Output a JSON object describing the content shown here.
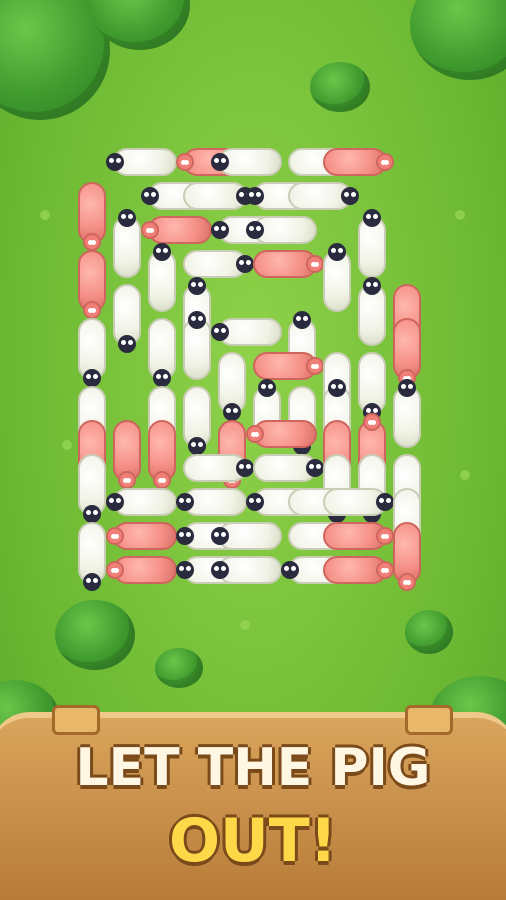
{
  "game": {
    "title_line1": "LET THE PIG",
    "title_line2": "OUT!",
    "colors": {
      "grass": "#72bd36",
      "sheep_body": "#f1f3e6",
      "sheep_head": "#2a2b3f",
      "pig_body": "#f48f86",
      "sign_wood": "#c98c45",
      "title_text": "#fff7e3",
      "title_accent": "#ffd84a"
    },
    "board": {
      "grid_columns": 9,
      "grid_rows": 13,
      "animals": [
        {
          "type": "sheep",
          "col": 1,
          "row": 0,
          "span": 2,
          "orient": "h",
          "facing": "left"
        },
        {
          "type": "pig",
          "col": 3,
          "row": 0,
          "span": 2,
          "orient": "h",
          "facing": "left"
        },
        {
          "type": "sheep",
          "col": 4,
          "row": 0,
          "span": 2,
          "orient": "h",
          "facing": "left"
        },
        {
          "type": "sheep",
          "col": 6,
          "row": 0,
          "span": 2,
          "orient": "h",
          "facing": "right"
        },
        {
          "type": "pig",
          "col": 7,
          "row": 0,
          "span": 2,
          "orient": "h",
          "facing": "right"
        },
        {
          "type": "pig",
          "col": 0,
          "row": 1,
          "span": 2,
          "orient": "v",
          "facing": "down"
        },
        {
          "type": "sheep",
          "col": 2,
          "row": 1,
          "span": 2,
          "orient": "h",
          "facing": "left"
        },
        {
          "type": "sheep",
          "col": 3,
          "row": 1,
          "span": 2,
          "orient": "h",
          "facing": "right"
        },
        {
          "type": "sheep",
          "col": 5,
          "row": 1,
          "span": 2,
          "orient": "h",
          "facing": "left"
        },
        {
          "type": "sheep",
          "col": 6,
          "row": 1,
          "span": 2,
          "orient": "h",
          "facing": "right"
        },
        {
          "type": "sheep",
          "col": 1,
          "row": 2,
          "span": 2,
          "orient": "v",
          "facing": "up"
        },
        {
          "type": "pig",
          "col": 2,
          "row": 2,
          "span": 2,
          "orient": "h",
          "facing": "left"
        },
        {
          "type": "sheep",
          "col": 4,
          "row": 2,
          "span": 2,
          "orient": "h",
          "facing": "left"
        },
        {
          "type": "sheep",
          "col": 5,
          "row": 2,
          "span": 2,
          "orient": "h",
          "facing": "left"
        },
        {
          "type": "sheep",
          "col": 8,
          "row": 2,
          "span": 2,
          "orient": "v",
          "facing": "up"
        },
        {
          "type": "pig",
          "col": 0,
          "row": 3,
          "span": 2,
          "orient": "v",
          "facing": "down"
        },
        {
          "type": "sheep",
          "col": 2,
          "row": 3,
          "span": 2,
          "orient": "v",
          "facing": "up"
        },
        {
          "type": "sheep",
          "col": 3,
          "row": 3,
          "span": 2,
          "orient": "h",
          "facing": "right"
        },
        {
          "type": "pig",
          "col": 5,
          "row": 3,
          "span": 2,
          "orient": "h",
          "facing": "right"
        },
        {
          "type": "sheep",
          "col": 7,
          "row": 3,
          "span": 2,
          "orient": "v",
          "facing": "up"
        },
        {
          "type": "sheep",
          "col": 8,
          "row": 4,
          "span": 2,
          "orient": "v",
          "facing": "up"
        },
        {
          "type": "pig",
          "col": 9,
          "row": 4,
          "span": 2,
          "orient": "v",
          "facing": "down"
        },
        {
          "type": "sheep",
          "col": 1,
          "row": 4,
          "span": 2,
          "orient": "v",
          "facing": "down"
        },
        {
          "type": "sheep",
          "col": 3,
          "row": 4,
          "span": 2,
          "orient": "v",
          "facing": "up"
        },
        {
          "type": "sheep",
          "col": 4,
          "row": 5,
          "span": 2,
          "orient": "h",
          "facing": "left"
        },
        {
          "type": "sheep",
          "col": 6,
          "row": 5,
          "span": 2,
          "orient": "v",
          "facing": "up"
        },
        {
          "type": "sheep",
          "col": 0,
          "row": 5,
          "span": 2,
          "orient": "v",
          "facing": "down"
        },
        {
          "type": "pig",
          "col": 9,
          "row": 5,
          "span": 2,
          "orient": "v",
          "facing": "down"
        },
        {
          "type": "sheep",
          "col": 2,
          "row": 5,
          "span": 2,
          "orient": "v",
          "facing": "down"
        },
        {
          "type": "sheep",
          "col": 3,
          "row": 5,
          "span": 2,
          "orient": "v",
          "facing": "up"
        },
        {
          "type": "sheep",
          "col": 4,
          "row": 6,
          "span": 2,
          "orient": "v",
          "facing": "down"
        },
        {
          "type": "pig",
          "col": 5,
          "row": 6,
          "span": 2,
          "orient": "h",
          "facing": "right"
        },
        {
          "type": "sheep",
          "col": 7,
          "row": 6,
          "span": 2,
          "orient": "v",
          "facing": "down"
        },
        {
          "type": "sheep",
          "col": 8,
          "row": 6,
          "span": 2,
          "orient": "v",
          "facing": "down"
        },
        {
          "type": "sheep",
          "col": 0,
          "row": 7,
          "span": 2,
          "orient": "v",
          "facing": "down"
        },
        {
          "type": "sheep",
          "col": 2,
          "row": 7,
          "span": 2,
          "orient": "v",
          "facing": "down"
        },
        {
          "type": "sheep",
          "col": 3,
          "row": 7,
          "span": 2,
          "orient": "v",
          "facing": "down"
        },
        {
          "type": "sheep",
          "col": 5,
          "row": 7,
          "span": 2,
          "orient": "v",
          "facing": "up"
        },
        {
          "type": "sheep",
          "col": 6,
          "row": 7,
          "span": 2,
          "orient": "v",
          "facing": "down"
        },
        {
          "type": "sheep",
          "col": 7,
          "row": 7,
          "span": 2,
          "orient": "v",
          "facing": "up"
        },
        {
          "type": "sheep",
          "col": 9,
          "row": 7,
          "span": 2,
          "orient": "v",
          "facing": "up"
        },
        {
          "type": "pig",
          "col": 0,
          "row": 8,
          "span": 2,
          "orient": "v",
          "facing": "down"
        },
        {
          "type": "pig",
          "col": 1,
          "row": 8,
          "span": 2,
          "orient": "v",
          "facing": "down"
        },
        {
          "type": "pig",
          "col": 2,
          "row": 8,
          "span": 2,
          "orient": "v",
          "facing": "down"
        },
        {
          "type": "pig",
          "col": 4,
          "row": 8,
          "span": 2,
          "orient": "v",
          "facing": "down"
        },
        {
          "type": "pig",
          "col": 5,
          "row": 8,
          "span": 2,
          "orient": "h",
          "facing": "left"
        },
        {
          "type": "pig",
          "col": 7,
          "row": 8,
          "span": 2,
          "orient": "v",
          "facing": "down"
        },
        {
          "type": "pig",
          "col": 8,
          "row": 8,
          "span": 2,
          "orient": "v",
          "facing": "up"
        },
        {
          "type": "sheep",
          "col": 0,
          "row": 9,
          "span": 2,
          "orient": "v",
          "facing": "down"
        },
        {
          "type": "sheep",
          "col": 3,
          "row": 9,
          "span": 2,
          "orient": "h",
          "facing": "right"
        },
        {
          "type": "sheep",
          "col": 5,
          "row": 9,
          "span": 2,
          "orient": "h",
          "facing": "right"
        },
        {
          "type": "sheep",
          "col": 7,
          "row": 9,
          "span": 2,
          "orient": "v",
          "facing": "down"
        },
        {
          "type": "sheep",
          "col": 8,
          "row": 9,
          "span": 2,
          "orient": "v",
          "facing": "down"
        },
        {
          "type": "sheep",
          "col": 9,
          "row": 9,
          "span": 2,
          "orient": "v",
          "facing": "down"
        },
        {
          "type": "sheep",
          "col": 1,
          "row": 10,
          "span": 2,
          "orient": "h",
          "facing": "left"
        },
        {
          "type": "sheep",
          "col": 3,
          "row": 10,
          "span": 2,
          "orient": "h",
          "facing": "left"
        },
        {
          "type": "sheep",
          "col": 5,
          "row": 10,
          "span": 2,
          "orient": "h",
          "facing": "left"
        },
        {
          "type": "sheep",
          "col": 6,
          "row": 10,
          "span": 2,
          "orient": "h",
          "facing": "right"
        },
        {
          "type": "sheep",
          "col": 7,
          "row": 10,
          "span": 2,
          "orient": "h",
          "facing": "right"
        },
        {
          "type": "sheep",
          "col": 9,
          "row": 10,
          "span": 2,
          "orient": "v",
          "facing": "down"
        },
        {
          "type": "sheep",
          "col": 0,
          "row": 11,
          "span": 2,
          "orient": "v",
          "facing": "down"
        },
        {
          "type": "pig",
          "col": 1,
          "row": 11,
          "span": 2,
          "orient": "h",
          "facing": "left"
        },
        {
          "type": "sheep",
          "col": 3,
          "row": 11,
          "span": 2,
          "orient": "h",
          "facing": "left"
        },
        {
          "type": "sheep",
          "col": 4,
          "row": 11,
          "span": 2,
          "orient": "h",
          "facing": "left"
        },
        {
          "type": "sheep",
          "col": 6,
          "row": 11,
          "span": 2,
          "orient": "h",
          "facing": "right"
        },
        {
          "type": "pig",
          "col": 7,
          "row": 11,
          "span": 2,
          "orient": "h",
          "facing": "right"
        },
        {
          "type": "pig",
          "col": 9,
          "row": 11,
          "span": 2,
          "orient": "v",
          "facing": "down"
        },
        {
          "type": "pig",
          "col": 1,
          "row": 12,
          "span": 2,
          "orient": "h",
          "facing": "left"
        },
        {
          "type": "sheep",
          "col": 3,
          "row": 12,
          "span": 2,
          "orient": "h",
          "facing": "left"
        },
        {
          "type": "sheep",
          "col": 4,
          "row": 12,
          "span": 2,
          "orient": "h",
          "facing": "left"
        },
        {
          "type": "sheep",
          "col": 6,
          "row": 12,
          "span": 2,
          "orient": "h",
          "facing": "left"
        },
        {
          "type": "pig",
          "col": 7,
          "row": 12,
          "span": 2,
          "orient": "h",
          "facing": "right"
        }
      ]
    }
  }
}
